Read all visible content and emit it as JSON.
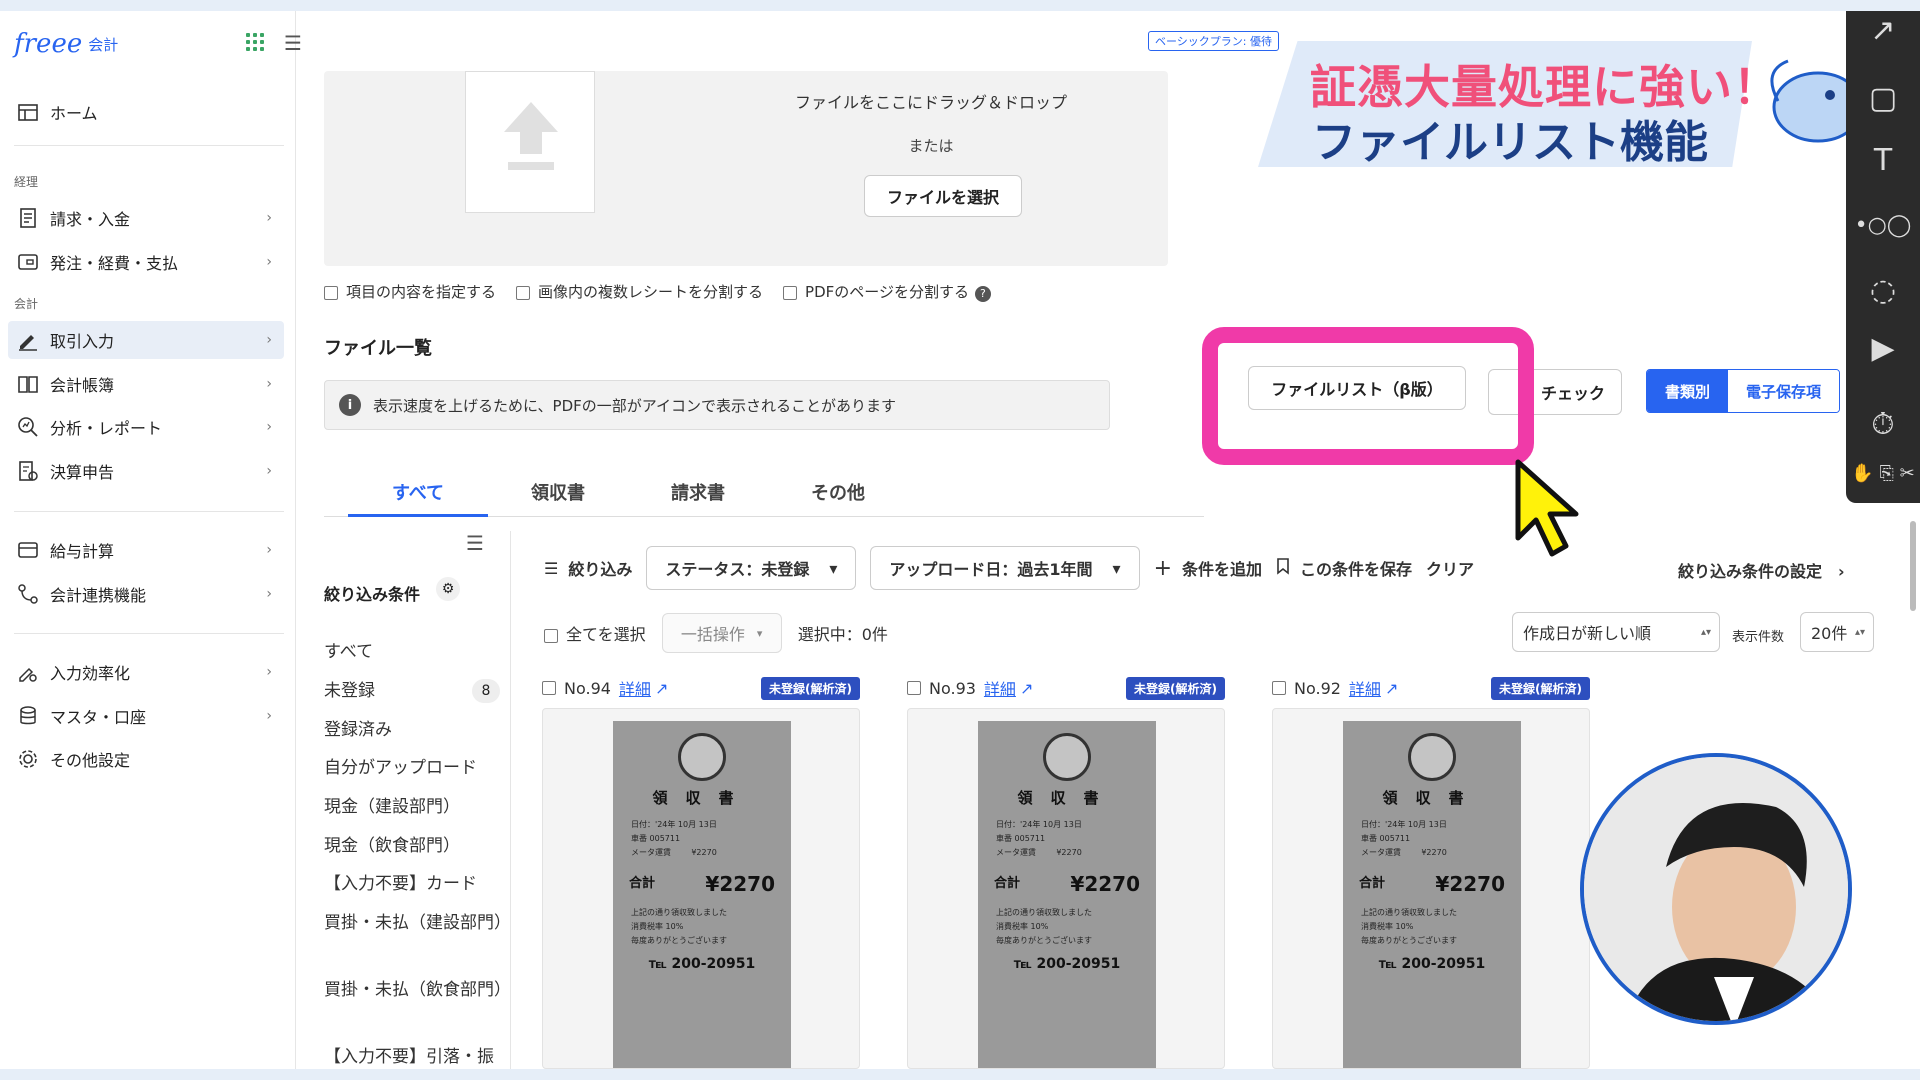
{
  "sidebar": {
    "logo": "freee",
    "logo_sub": "会計",
    "sections": {
      "keiri": "経理",
      "kaikei": "会計"
    },
    "items": [
      {
        "label": "ホーム"
      },
      {
        "label": "請求・入金"
      },
      {
        "label": "発注・経費・支払"
      },
      {
        "label": "取引入力"
      },
      {
        "label": "会計帳簿"
      },
      {
        "label": "分析・レポート"
      },
      {
        "label": "決算申告"
      },
      {
        "label": "給与計算"
      },
      {
        "label": "会計連携機能"
      },
      {
        "label": "入力効率化"
      },
      {
        "label": "マスタ・口座"
      },
      {
        "label": "その他設定"
      }
    ],
    "active_item": "取引入力"
  },
  "header": {
    "plan_badge": "ベーシックプラン: 優待"
  },
  "upload": {
    "drop_text": "ファイルをここにドラッグ＆ドロップ",
    "or_text": "または",
    "select_file_button": "ファイルを選択"
  },
  "options": [
    "項目の内容を指定する",
    "画像内の複数レシートを分割する",
    "PDFのページを分割する"
  ],
  "file_list": {
    "title": "ファイル一覧",
    "notice": "表示速度を上げるために、PDFの一部がアイコンで表示されることがあります",
    "file_list_button": "ファイルリスト（β版）",
    "check_button": "チェック",
    "view_toggle": [
      "書類別",
      "電子保存項"
    ]
  },
  "tabs": [
    "すべて",
    "領収書",
    "請求書",
    "その他"
  ],
  "active_tab": "すべて",
  "filter_panel": {
    "title": "絞り込み条件",
    "items": [
      "すべて",
      "未登録",
      "登録済み",
      "自分がアップロード",
      "現金（建設部門）",
      "現金（飲食部門）",
      "【入力不要】カード",
      "買掛・未払（建設部門）",
      "買掛・未払（飲食部門）",
      "【入力不要】引落・振替"
    ],
    "unregistered_count": "8"
  },
  "filter_bar": {
    "filter_label": "絞り込み",
    "status": "ステータス：未登録",
    "upload_date": "アップロード日：過去1年間",
    "add_condition": "条件を追加",
    "save_condition": "この条件を保存",
    "clear": "クリア",
    "settings": "絞り込み条件の設定"
  },
  "selection": {
    "select_all": "全てを選択",
    "bulk_action": "一括操作",
    "selected": "選択中：0件",
    "sort": "作成日が新しい順",
    "per_page_label": "表示件数",
    "per_page": "20件"
  },
  "cards": [
    {
      "no": "No.94",
      "detail": "詳細",
      "badge": "未登録(解析済)"
    },
    {
      "no": "No.93",
      "detail": "詳細",
      "badge": "未登録(解析済)"
    },
    {
      "no": "No.92",
      "detail": "詳細",
      "badge": "未登録(解析済)"
    }
  ],
  "receipt": {
    "title": "領収書",
    "date": "日付：'24年 10月 13日",
    "car": "車番 005711",
    "meter": "メータ運賃",
    "meter_value": "¥2270",
    "total_label": "合計",
    "total": "¥2270",
    "note": "上記の通り領収致しました",
    "tax": "消費税率 10%",
    "thanks": "毎度ありがとうございます",
    "tel": "℡ 200-20951"
  },
  "banner": {
    "line1": "証憑大量処理に強い！",
    "line2": "ファイルリスト機能"
  },
  "colors": {
    "accent": "#2864f0",
    "highlight": "#f03aa8",
    "badge": "#2d4fbf",
    "banner_pink": "#f0507a",
    "banner_navy": "#1c3f86"
  }
}
